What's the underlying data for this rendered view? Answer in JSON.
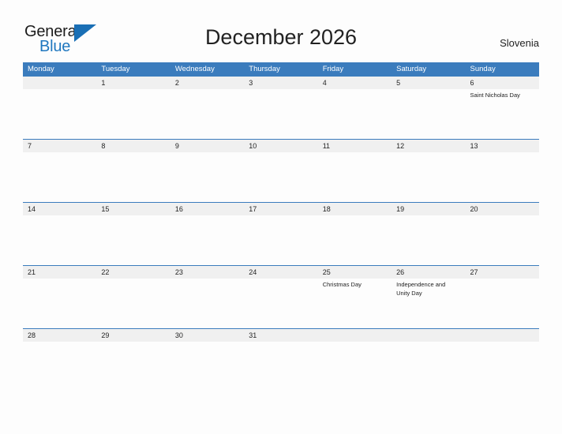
{
  "brand": {
    "word_one": "General",
    "word_two": "Blue",
    "triangle_icon": "triangle-icon",
    "accent_color": "#1a6fb5"
  },
  "header": {
    "title": "December 2026",
    "country": "Slovenia"
  },
  "theme": {
    "header_blue": "#3b7cbd",
    "band_gray": "#f0f0f0",
    "page_background": "#fdfdfd",
    "text": "#232323"
  },
  "calendar": {
    "weekdays": [
      "Monday",
      "Tuesday",
      "Wednesday",
      "Thursday",
      "Friday",
      "Saturday",
      "Sunday"
    ],
    "weeks": [
      [
        {
          "date": "",
          "event": ""
        },
        {
          "date": "1",
          "event": ""
        },
        {
          "date": "2",
          "event": ""
        },
        {
          "date": "3",
          "event": ""
        },
        {
          "date": "4",
          "event": ""
        },
        {
          "date": "5",
          "event": ""
        },
        {
          "date": "6",
          "event": "Saint Nicholas Day"
        }
      ],
      [
        {
          "date": "7",
          "event": ""
        },
        {
          "date": "8",
          "event": ""
        },
        {
          "date": "9",
          "event": ""
        },
        {
          "date": "10",
          "event": ""
        },
        {
          "date": "11",
          "event": ""
        },
        {
          "date": "12",
          "event": ""
        },
        {
          "date": "13",
          "event": ""
        }
      ],
      [
        {
          "date": "14",
          "event": ""
        },
        {
          "date": "15",
          "event": ""
        },
        {
          "date": "16",
          "event": ""
        },
        {
          "date": "17",
          "event": ""
        },
        {
          "date": "18",
          "event": ""
        },
        {
          "date": "19",
          "event": ""
        },
        {
          "date": "20",
          "event": ""
        }
      ],
      [
        {
          "date": "21",
          "event": ""
        },
        {
          "date": "22",
          "event": ""
        },
        {
          "date": "23",
          "event": ""
        },
        {
          "date": "24",
          "event": ""
        },
        {
          "date": "25",
          "event": "Christmas Day"
        },
        {
          "date": "26",
          "event": "Independence and Unity Day"
        },
        {
          "date": "27",
          "event": ""
        }
      ],
      [
        {
          "date": "28",
          "event": ""
        },
        {
          "date": "29",
          "event": ""
        },
        {
          "date": "30",
          "event": ""
        },
        {
          "date": "31",
          "event": ""
        },
        {
          "date": "",
          "event": ""
        },
        {
          "date": "",
          "event": ""
        },
        {
          "date": "",
          "event": ""
        }
      ]
    ]
  }
}
